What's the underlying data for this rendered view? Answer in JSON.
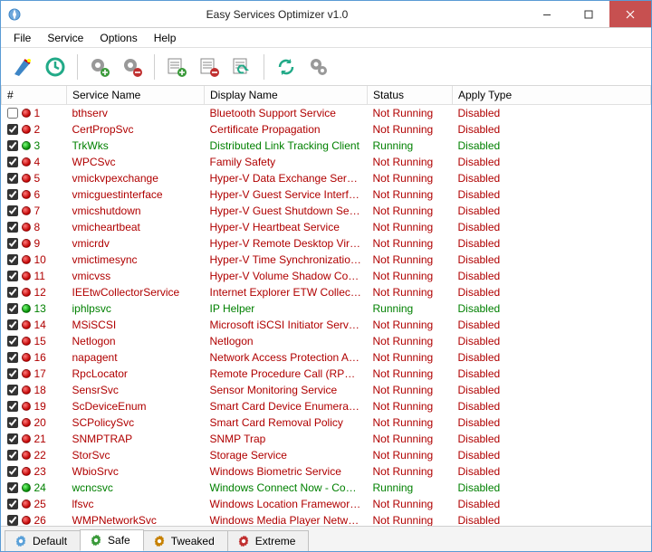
{
  "window": {
    "title": "Easy Services Optimizer v1.0"
  },
  "menu": {
    "file": "File",
    "service": "Service",
    "options": "Options",
    "help": "Help"
  },
  "columns": {
    "num": "#",
    "serviceName": "Service Name",
    "displayName": "Display Name",
    "status": "Status",
    "applyType": "Apply Type"
  },
  "rows": [
    {
      "n": 1,
      "checked": false,
      "dot": "red",
      "svc": "bthserv",
      "disp": "Bluetooth Support Service",
      "status": "Not Running",
      "apply": "Disabled",
      "cls": "red"
    },
    {
      "n": 2,
      "checked": true,
      "dot": "red",
      "svc": "CertPropSvc",
      "disp": "Certificate Propagation",
      "status": "Not Running",
      "apply": "Disabled",
      "cls": "red"
    },
    {
      "n": 3,
      "checked": true,
      "dot": "green",
      "svc": "TrkWks",
      "disp": "Distributed Link Tracking Client",
      "status": "Running",
      "apply": "Disabled",
      "cls": "green"
    },
    {
      "n": 4,
      "checked": true,
      "dot": "red",
      "svc": "WPCSvc",
      "disp": "Family Safety",
      "status": "Not Running",
      "apply": "Disabled",
      "cls": "red"
    },
    {
      "n": 5,
      "checked": true,
      "dot": "red",
      "svc": "vmickvpexchange",
      "disp": "Hyper-V Data Exchange Service",
      "status": "Not Running",
      "apply": "Disabled",
      "cls": "red"
    },
    {
      "n": 6,
      "checked": true,
      "dot": "red",
      "svc": "vmicguestinterface",
      "disp": "Hyper-V Guest Service Interface",
      "status": "Not Running",
      "apply": "Disabled",
      "cls": "red"
    },
    {
      "n": 7,
      "checked": true,
      "dot": "red",
      "svc": "vmicshutdown",
      "disp": "Hyper-V Guest Shutdown Service",
      "status": "Not Running",
      "apply": "Disabled",
      "cls": "red"
    },
    {
      "n": 8,
      "checked": true,
      "dot": "red",
      "svc": "vmicheartbeat",
      "disp": "Hyper-V Heartbeat Service",
      "status": "Not Running",
      "apply": "Disabled",
      "cls": "red"
    },
    {
      "n": 9,
      "checked": true,
      "dot": "red",
      "svc": "vmicrdv",
      "disp": "Hyper-V Remote Desktop Virtu...",
      "status": "Not Running",
      "apply": "Disabled",
      "cls": "red"
    },
    {
      "n": 10,
      "checked": true,
      "dot": "red",
      "svc": "vmictimesync",
      "disp": "Hyper-V Time Synchronization ...",
      "status": "Not Running",
      "apply": "Disabled",
      "cls": "red"
    },
    {
      "n": 11,
      "checked": true,
      "dot": "red",
      "svc": "vmicvss",
      "disp": "Hyper-V Volume Shadow Copy ...",
      "status": "Not Running",
      "apply": "Disabled",
      "cls": "red"
    },
    {
      "n": 12,
      "checked": true,
      "dot": "red",
      "svc": "IEEtwCollectorService",
      "disp": "Internet Explorer ETW Collecto...",
      "status": "Not Running",
      "apply": "Disabled",
      "cls": "red"
    },
    {
      "n": 13,
      "checked": true,
      "dot": "green",
      "svc": "iphlpsvc",
      "disp": "IP Helper",
      "status": "Running",
      "apply": "Disabled",
      "cls": "green"
    },
    {
      "n": 14,
      "checked": true,
      "dot": "red",
      "svc": "MSiSCSI",
      "disp": "Microsoft iSCSI Initiator Service",
      "status": "Not Running",
      "apply": "Disabled",
      "cls": "red"
    },
    {
      "n": 15,
      "checked": true,
      "dot": "red",
      "svc": "Netlogon",
      "disp": "Netlogon",
      "status": "Not Running",
      "apply": "Disabled",
      "cls": "red"
    },
    {
      "n": 16,
      "checked": true,
      "dot": "red",
      "svc": "napagent",
      "disp": "Network Access Protection Agent",
      "status": "Not Running",
      "apply": "Disabled",
      "cls": "red"
    },
    {
      "n": 17,
      "checked": true,
      "dot": "red",
      "svc": "RpcLocator",
      "disp": "Remote Procedure Call (RPC) L...",
      "status": "Not Running",
      "apply": "Disabled",
      "cls": "red"
    },
    {
      "n": 18,
      "checked": true,
      "dot": "red",
      "svc": "SensrSvc",
      "disp": "Sensor Monitoring Service",
      "status": "Not Running",
      "apply": "Disabled",
      "cls": "red"
    },
    {
      "n": 19,
      "checked": true,
      "dot": "red",
      "svc": "ScDeviceEnum",
      "disp": "Smart Card Device Enumeratio...",
      "status": "Not Running",
      "apply": "Disabled",
      "cls": "red"
    },
    {
      "n": 20,
      "checked": true,
      "dot": "red",
      "svc": "SCPolicySvc",
      "disp": "Smart Card Removal Policy",
      "status": "Not Running",
      "apply": "Disabled",
      "cls": "red"
    },
    {
      "n": 21,
      "checked": true,
      "dot": "red",
      "svc": "SNMPTRAP",
      "disp": "SNMP Trap",
      "status": "Not Running",
      "apply": "Disabled",
      "cls": "red"
    },
    {
      "n": 22,
      "checked": true,
      "dot": "red",
      "svc": "StorSvc",
      "disp": "Storage Service",
      "status": "Not Running",
      "apply": "Disabled",
      "cls": "red"
    },
    {
      "n": 23,
      "checked": true,
      "dot": "red",
      "svc": "WbioSrvc",
      "disp": "Windows Biometric Service",
      "status": "Not Running",
      "apply": "Disabled",
      "cls": "red"
    },
    {
      "n": 24,
      "checked": true,
      "dot": "green",
      "svc": "wcncsvc",
      "disp": "Windows Connect Now - Config...",
      "status": "Running",
      "apply": "Disabled",
      "cls": "green"
    },
    {
      "n": 25,
      "checked": true,
      "dot": "red",
      "svc": "lfsvc",
      "disp": "Windows Location Framework S...",
      "status": "Not Running",
      "apply": "Disabled",
      "cls": "red"
    },
    {
      "n": 26,
      "checked": true,
      "dot": "red",
      "svc": "WMPNetworkSvc",
      "disp": "Windows Media Player Network...",
      "status": "Not Running",
      "apply": "Disabled",
      "cls": "red"
    }
  ],
  "tabs": {
    "default": "Default",
    "safe": "Safe",
    "tweaked": "Tweaked",
    "extreme": "Extreme",
    "active": "safe"
  }
}
